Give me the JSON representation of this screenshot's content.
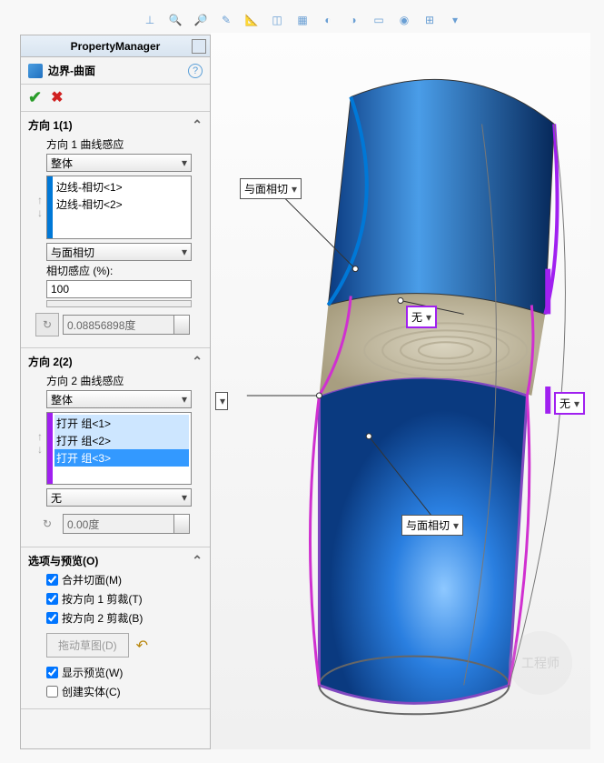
{
  "pm_title": "PropertyManager",
  "feature_title": "边界-曲面",
  "dir1": {
    "header": "方向 1(1)",
    "curve_label": "方向 1 曲线感应",
    "curve_value": "整体",
    "edges": [
      "边线-相切<1>",
      "边线-相切<2>"
    ],
    "tangent_value": "与面相切",
    "tangent_pct_label": "相切感应 (%):",
    "pct": "100",
    "angle": "0.08856898度"
  },
  "dir2": {
    "header": "方向 2(2)",
    "curve_label": "方向 2 曲线感应",
    "curve_value": "整体",
    "groups": [
      "打开 组<1>",
      "打开 组<2>",
      "打开 组<3>"
    ],
    "tangent_value": "无",
    "angle": "0.00度"
  },
  "options": {
    "header": "选项与预览(O)",
    "merge": "合并切面(M)",
    "trim1": "按方向 1 剪裁(T)",
    "trim2": "按方向 2 剪裁(B)",
    "drag": "拖动草图(D)",
    "preview": "显示预览(W)",
    "solid": "创建实体(C)"
  },
  "callouts": {
    "c1": "与面相切",
    "c2": "无",
    "c3": "无",
    "c4": "与面相切"
  }
}
